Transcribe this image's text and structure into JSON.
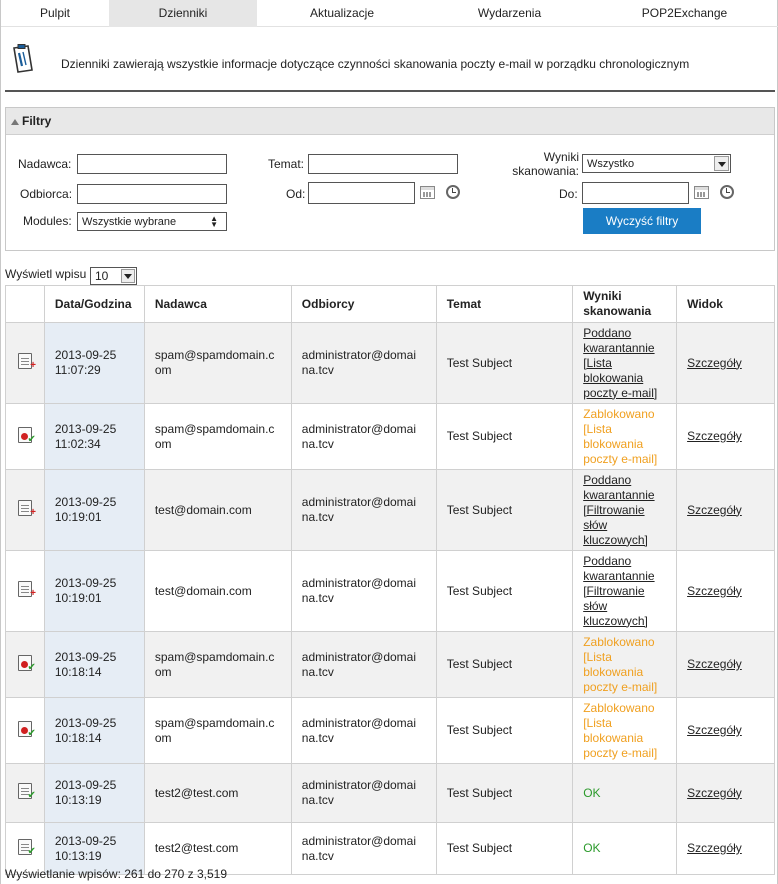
{
  "nav": {
    "tabs": [
      {
        "label": "Pulpit"
      },
      {
        "label": "Dzienniki"
      },
      {
        "label": "Aktualizacje"
      },
      {
        "label": "Wydarzenia"
      },
      {
        "label": "POP2Exchange"
      }
    ],
    "active_index": 1
  },
  "banner": {
    "icon": "clipboard-icon",
    "text": "Dzienniki zawierają wszystkie informacje dotyczące czynności skanowania poczty e-mail w porządku chronologicznym"
  },
  "filters": {
    "title": "Filtry",
    "sender_label": "Nadawca:",
    "sender_value": "",
    "recipient_label": "Odbiorca:",
    "recipient_value": "",
    "modules_label": "Modules:",
    "modules_value": "Wszystkie wybrane",
    "subject_label": "Temat:",
    "subject_value": "",
    "from_label": "Od:",
    "from_value": "",
    "result_label_1": "Wyniki",
    "result_label_2": "skanowania:",
    "result_value": "Wszystko",
    "to_label": "Do:",
    "to_value": "",
    "clear_button": "Wyczyść filtry"
  },
  "pager": {
    "per_page_label": "Wyświetl wpisu",
    "per_page_value": "10",
    "summary": "Wyświetlanie wpisów: 261 do 270 z 3,519"
  },
  "table": {
    "columns": [
      "Data/Godzina",
      "Nadawca",
      "Odbiorcy",
      "Temat",
      "Wyniki skanowania",
      "Widok"
    ],
    "rows": [
      {
        "icon": "quarantine",
        "date": "2013-09-25",
        "time": "11:07:29",
        "sender_1": "spam@spamdomain.c",
        "sender_2": "om",
        "rcpt_1": "administrator@domai",
        "rcpt_2": "na.tcv",
        "subject": "Test Subject",
        "status": "quarantine",
        "result": [
          "Poddano",
          "kwarantannie",
          "[Lista",
          "blokowania",
          "poczty e-mail]"
        ],
        "view": "Szczegóły"
      },
      {
        "icon": "blocked",
        "date": "2013-09-25",
        "time": "11:02:34",
        "sender_1": "spam@spamdomain.c",
        "sender_2": "om",
        "rcpt_1": "administrator@domai",
        "rcpt_2": "na.tcv",
        "subject": "Test Subject",
        "status": "blocked",
        "result": [
          "Zablokowano",
          "[Lista",
          "blokowania",
          "poczty e-mail]"
        ],
        "view": "Szczegóły"
      },
      {
        "icon": "quarantine",
        "date": "2013-09-25",
        "time": "10:19:01",
        "sender_1": "test@domain.com",
        "sender_2": "",
        "rcpt_1": "administrator@domai",
        "rcpt_2": "na.tcv",
        "subject": "Test Subject",
        "status": "quarantine",
        "result": [
          "Poddano",
          "kwarantannie",
          "[Filtrowanie",
          "słów",
          "kluczowych]"
        ],
        "view": "Szczegóły"
      },
      {
        "icon": "quarantine",
        "date": "2013-09-25",
        "time": "10:19:01",
        "sender_1": "test@domain.com",
        "sender_2": "",
        "rcpt_1": "administrator@domai",
        "rcpt_2": "na.tcv",
        "subject": "Test Subject",
        "status": "quarantine",
        "result": [
          "Poddano",
          "kwarantannie",
          "[Filtrowanie",
          "słów",
          "kluczowych]"
        ],
        "view": "Szczegóły"
      },
      {
        "icon": "blocked",
        "date": "2013-09-25",
        "time": "10:18:14",
        "sender_1": "spam@spamdomain.c",
        "sender_2": "om",
        "rcpt_1": "administrator@domai",
        "rcpt_2": "na.tcv",
        "subject": "Test Subject",
        "status": "blocked",
        "result": [
          "Zablokowano",
          "[Lista",
          "blokowania",
          "poczty e-mail]"
        ],
        "view": "Szczegóły"
      },
      {
        "icon": "blocked",
        "date": "2013-09-25",
        "time": "10:18:14",
        "sender_1": "spam@spamdomain.c",
        "sender_2": "om",
        "rcpt_1": "administrator@domai",
        "rcpt_2": "na.tcv",
        "subject": "Test Subject",
        "status": "blocked",
        "result": [
          "Zablokowano",
          "[Lista",
          "blokowania",
          "poczty e-mail]"
        ],
        "view": "Szczegóły"
      },
      {
        "icon": "ok",
        "date": "2013-09-25",
        "time": "10:13:19",
        "sender_1": "test2@test.com",
        "sender_2": "",
        "rcpt_1": "administrator@domai",
        "rcpt_2": "na.tcv",
        "subject": "Test Subject",
        "status": "ok",
        "result": [
          "OK"
        ],
        "view": "Szczegóły"
      },
      {
        "icon": "ok",
        "date": "2013-09-25",
        "time": "10:13:19",
        "sender_1": "test2@test.com",
        "sender_2": "",
        "rcpt_1": "administrator@domai",
        "rcpt_2": "na.tcv",
        "subject": "Test Subject",
        "status": "ok",
        "result": [
          "OK"
        ],
        "view": "Szczegóły"
      }
    ]
  },
  "colors": {
    "accent": "#1a7dc5",
    "blocked": "#f0a020",
    "ok": "#2b9a2b",
    "date_column_bg": "#e6edf5"
  }
}
